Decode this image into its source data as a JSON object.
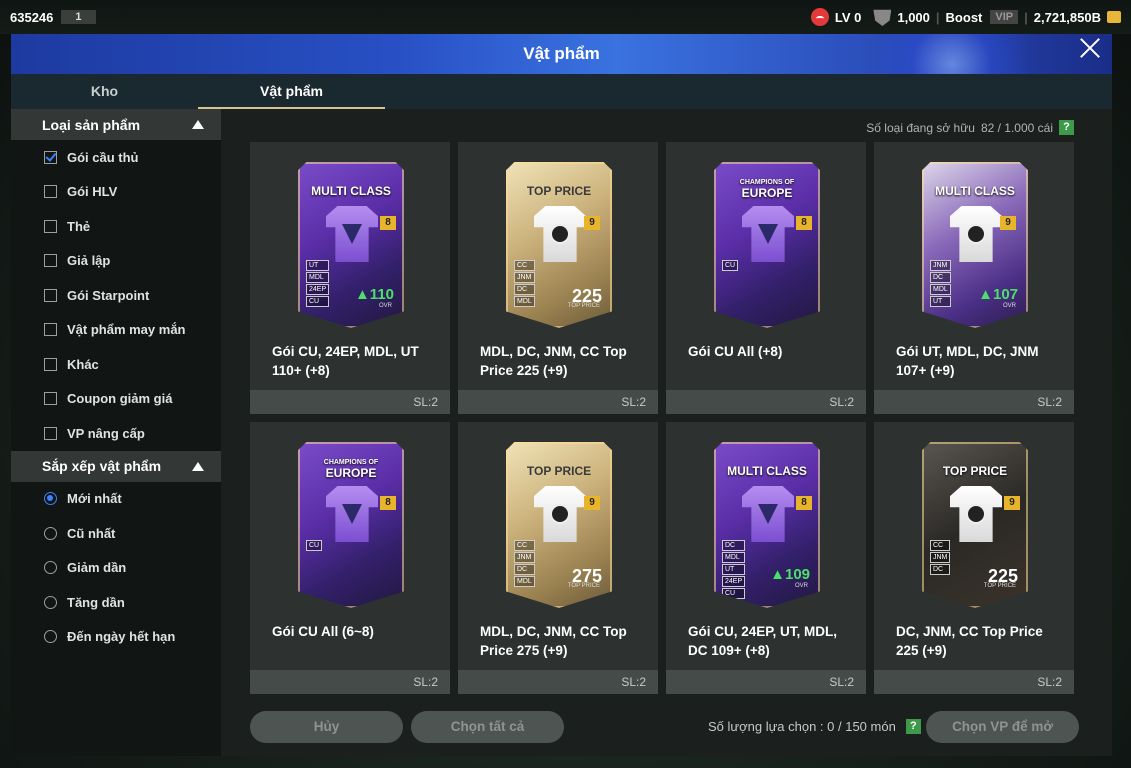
{
  "topbar": {
    "uid": "635246",
    "uid_num": "1",
    "level": "LV 0",
    "points": "1,000",
    "boost": "Boost",
    "vip": "VIP",
    "coins": "2,721,850B"
  },
  "window": {
    "title": "Vật phẩm",
    "tabs": [
      {
        "label": "Kho",
        "active": false
      },
      {
        "label": "Vật phẩm",
        "active": true
      }
    ]
  },
  "sidebar": {
    "type_header": "Loại sản phẩm",
    "types": [
      {
        "label": "Gói cầu thủ",
        "checked": true
      },
      {
        "label": "Gói HLV",
        "checked": false
      },
      {
        "label": "Thẻ",
        "checked": false
      },
      {
        "label": "Giả lập",
        "checked": false
      },
      {
        "label": "Gói Starpoint",
        "checked": false
      },
      {
        "label": "Vật phẩm may mắn",
        "checked": false
      },
      {
        "label": "Khác",
        "checked": false
      },
      {
        "label": "Coupon giảm giá",
        "checked": false
      },
      {
        "label": "VP nâng cấp",
        "checked": false
      }
    ],
    "sort_header": "Sắp xếp vật phẩm",
    "sorts": [
      {
        "label": "Mới nhất",
        "selected": true
      },
      {
        "label": "Cũ nhất",
        "selected": false
      },
      {
        "label": "Giảm dần",
        "selected": false
      },
      {
        "label": "Tăng dần",
        "selected": false
      },
      {
        "label": "Đến ngày hết hạn",
        "selected": false
      }
    ]
  },
  "owned": {
    "label": "Số loại đang sở hữu",
    "value": "82 / 1.000 cái",
    "help": "?"
  },
  "items": [
    {
      "name": "Gói CU, 24EP, MDL, UT 110+ (+8)",
      "qty": "SL:2",
      "card": {
        "style": "purple",
        "label": "MULTI CLASS",
        "badge": "8",
        "positions": [
          "UT",
          "MDL",
          "24EP",
          "CU"
        ],
        "ovr": "▲110",
        "ovr_sub": "OVR"
      }
    },
    {
      "name": "MDL, DC, JNM, CC Top Price 225 (+9)",
      "qty": "SL:2",
      "card": {
        "style": "gold",
        "label": "TOP PRICE",
        "badge": "9",
        "positions": [
          "CC",
          "JNM",
          "DC",
          "MDL"
        ],
        "ovr": "225",
        "ovr_sub": "TOP PRICE"
      }
    },
    {
      "name": "Gói CU All (+8)",
      "qty": "SL:2",
      "card": {
        "style": "purple",
        "label_top": "CHAMPIONS OF",
        "label": "EUROPE",
        "badge": "8",
        "positions": [
          "CU"
        ],
        "ovr": "",
        "ovr_sub": ""
      }
    },
    {
      "name": "Gói UT, MDL, DC, JNM 107+ (+9)",
      "qty": "SL:2",
      "card": {
        "style": "mc-white",
        "label": "MULTI CLASS",
        "badge": "9",
        "positions": [
          "JNM",
          "DC",
          "MDL",
          "UT"
        ],
        "ovr": "▲107",
        "ovr_sub": "OVR"
      }
    },
    {
      "name": "Gói CU All (6~8)",
      "qty": "SL:2",
      "card": {
        "style": "purple",
        "label_top": "CHAMPIONS OF",
        "label": "EUROPE",
        "badge": "8",
        "positions": [
          "CU"
        ],
        "ovr": "",
        "ovr_sub": ""
      }
    },
    {
      "name": "MDL, DC, JNM, CC Top Price 275 (+9)",
      "qty": "SL:2",
      "card": {
        "style": "gold",
        "label": "TOP PRICE",
        "badge": "9",
        "positions": [
          "CC",
          "JNM",
          "DC",
          "MDL"
        ],
        "ovr": "275",
        "ovr_sub": "TOP PRICE"
      }
    },
    {
      "name": "Gói CU, 24EP, UT, MDL, DC 109+ (+8)",
      "qty": "SL:2",
      "card": {
        "style": "purple",
        "label": "MULTI CLASS",
        "badge": "8",
        "positions": [
          "DC",
          "MDL",
          "UT",
          "24EP",
          "CU"
        ],
        "ovr": "▲109",
        "ovr_sub": "OVR"
      }
    },
    {
      "name": "DC, JNM, CC Top Price 225 (+9)",
      "qty": "SL:2",
      "card": {
        "style": "dark",
        "label": "TOP PRICE",
        "badge": "9",
        "positions": [
          "CC",
          "JNM",
          "DC"
        ],
        "ovr": "225",
        "ovr_sub": "TOP PRICE"
      }
    }
  ],
  "footer": {
    "cancel": "Hủy",
    "select_all": "Chọn tất cả",
    "selection_label": "Số lượng lựa chọn : 0 / 150 món",
    "help": "?",
    "open": "Chọn VP để mở"
  }
}
